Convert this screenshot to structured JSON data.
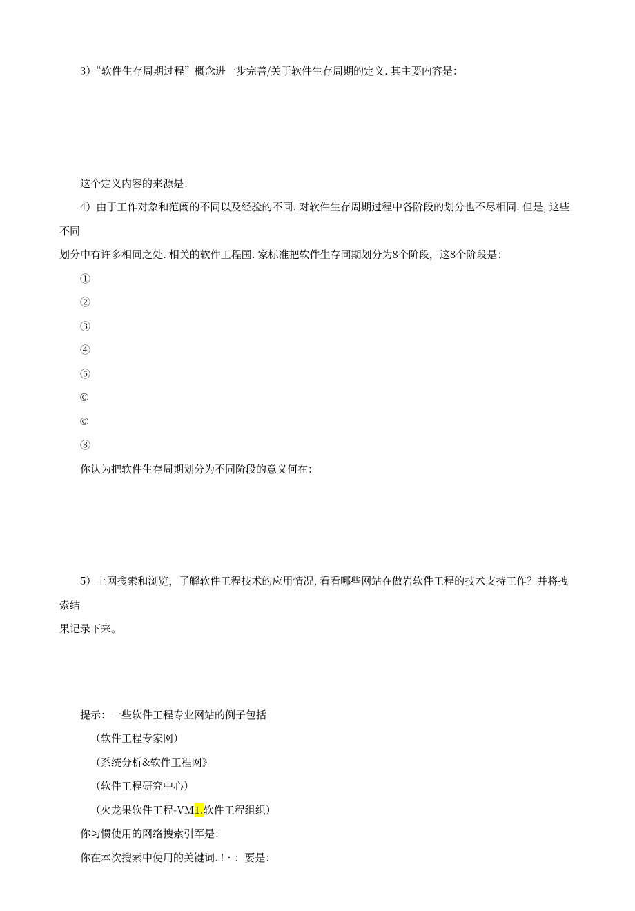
{
  "q3": {
    "prompt": "3）“软件生存周期过程”概念进一步完善/关于软件生存周期的定义. 其主要内容是：",
    "source_label": "这个定义内容的来源是："
  },
  "q4": {
    "prompt_line1": "4）由于工作对象和范阚的不同以及经验的不同. 对软件生存周期过程中各阶段的划分也不尽相同. 但是, 这些不同",
    "prompt_line2": "划分中有许多相同之处. 相关的软件工程国. 家标准把软件生存同期划分为8个阶段，这8个阶段是：",
    "items": [
      "①",
      "②",
      "③",
      "④",
      "⑤",
      "©",
      "©",
      "⑧"
    ],
    "followup": "你认为把软件生存周期划分为不同阶段的意义何在："
  },
  "q5": {
    "prompt_line1": "5）上网搜索和浏览，了解软件工程技术的应用情况, 看看哪些网站在做岩软件工程的技术支持工作？并将拽索结",
    "prompt_line2": "果记录下来。",
    "hint_intro": "提示：一些软件工程专业网站的例子包括",
    "sites": [
      "（软件工程专家网）",
      "（系统分析&软件工程网》",
      "（软件工程研究中心）"
    ],
    "site_special_pre": "（火龙果软件工程-VM",
    "site_special_hl": "1.",
    "site_special_post": "软件工程组织）",
    "engine_q": "你习惯使用的网络搜索引军是：",
    "keyword_q": "你在本次搜索中使用的关键词. !•：要是："
  }
}
